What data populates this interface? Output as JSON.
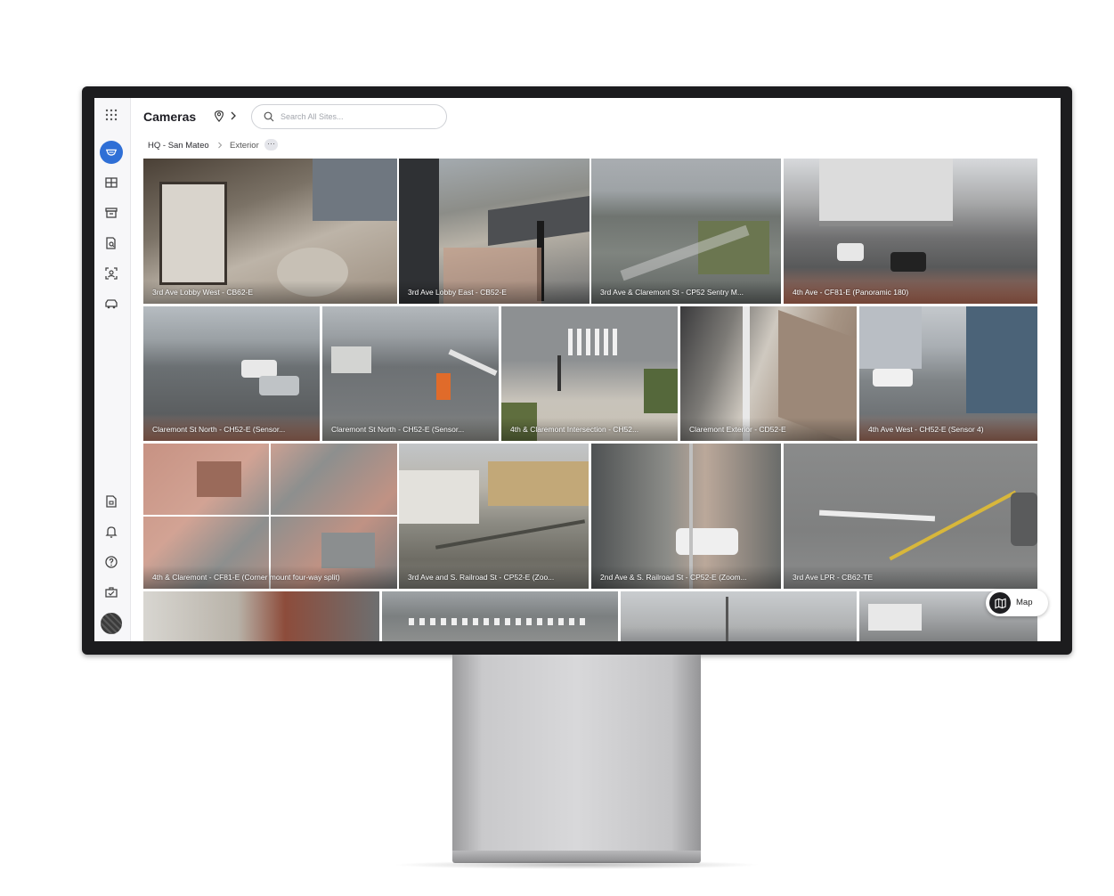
{
  "header": {
    "title": "Cameras",
    "search_placeholder": "Search All Sites..."
  },
  "breadcrumb": {
    "site": "HQ - San Mateo",
    "group": "Exterior",
    "more": "···"
  },
  "sidebar": {
    "icons": [
      "apps-grid-icon",
      "cameras-icon",
      "grid-view-icon",
      "archive-icon",
      "search-doc-icon",
      "face-scan-icon",
      "vehicle-icon",
      "report-icon",
      "bell-icon",
      "help-icon",
      "toolbox-icon"
    ]
  },
  "cameras": [
    {
      "label": "3rd Ave Lobby West - CB62-E"
    },
    {
      "label": "3rd Ave Lobby East - CB52-E"
    },
    {
      "label": "3rd Ave & Claremont St - CP52 Sentry M..."
    },
    {
      "label": "4th Ave - CF81-E (Panoramic 180)"
    },
    {
      "label": "Claremont St North - CH52-E (Sensor..."
    },
    {
      "label": "Claremont St North - CH52-E (Sensor..."
    },
    {
      "label": "4th & Claremont Intersection - CH52..."
    },
    {
      "label": "Claremont Exterior - CD52-E"
    },
    {
      "label": "4th Ave West - CH52-E (Sensor 4)"
    },
    {
      "label": "4th & Claremont - CF81-E (Corner mount four-way split)"
    },
    {
      "label": "3rd Ave and S. Railroad St - CP52-E (Zoo..."
    },
    {
      "label": "2nd Ave & S. Railroad St - CP52-E (Zoom..."
    },
    {
      "label": "3rd Ave LPR - CB62-TE"
    },
    {
      "label": ""
    },
    {
      "label": ""
    },
    {
      "label": ""
    },
    {
      "label": ""
    }
  ],
  "map_button": {
    "label": "Map"
  },
  "colors": {
    "accent": "#2f6fd6",
    "frame": "#1c1c1e"
  }
}
